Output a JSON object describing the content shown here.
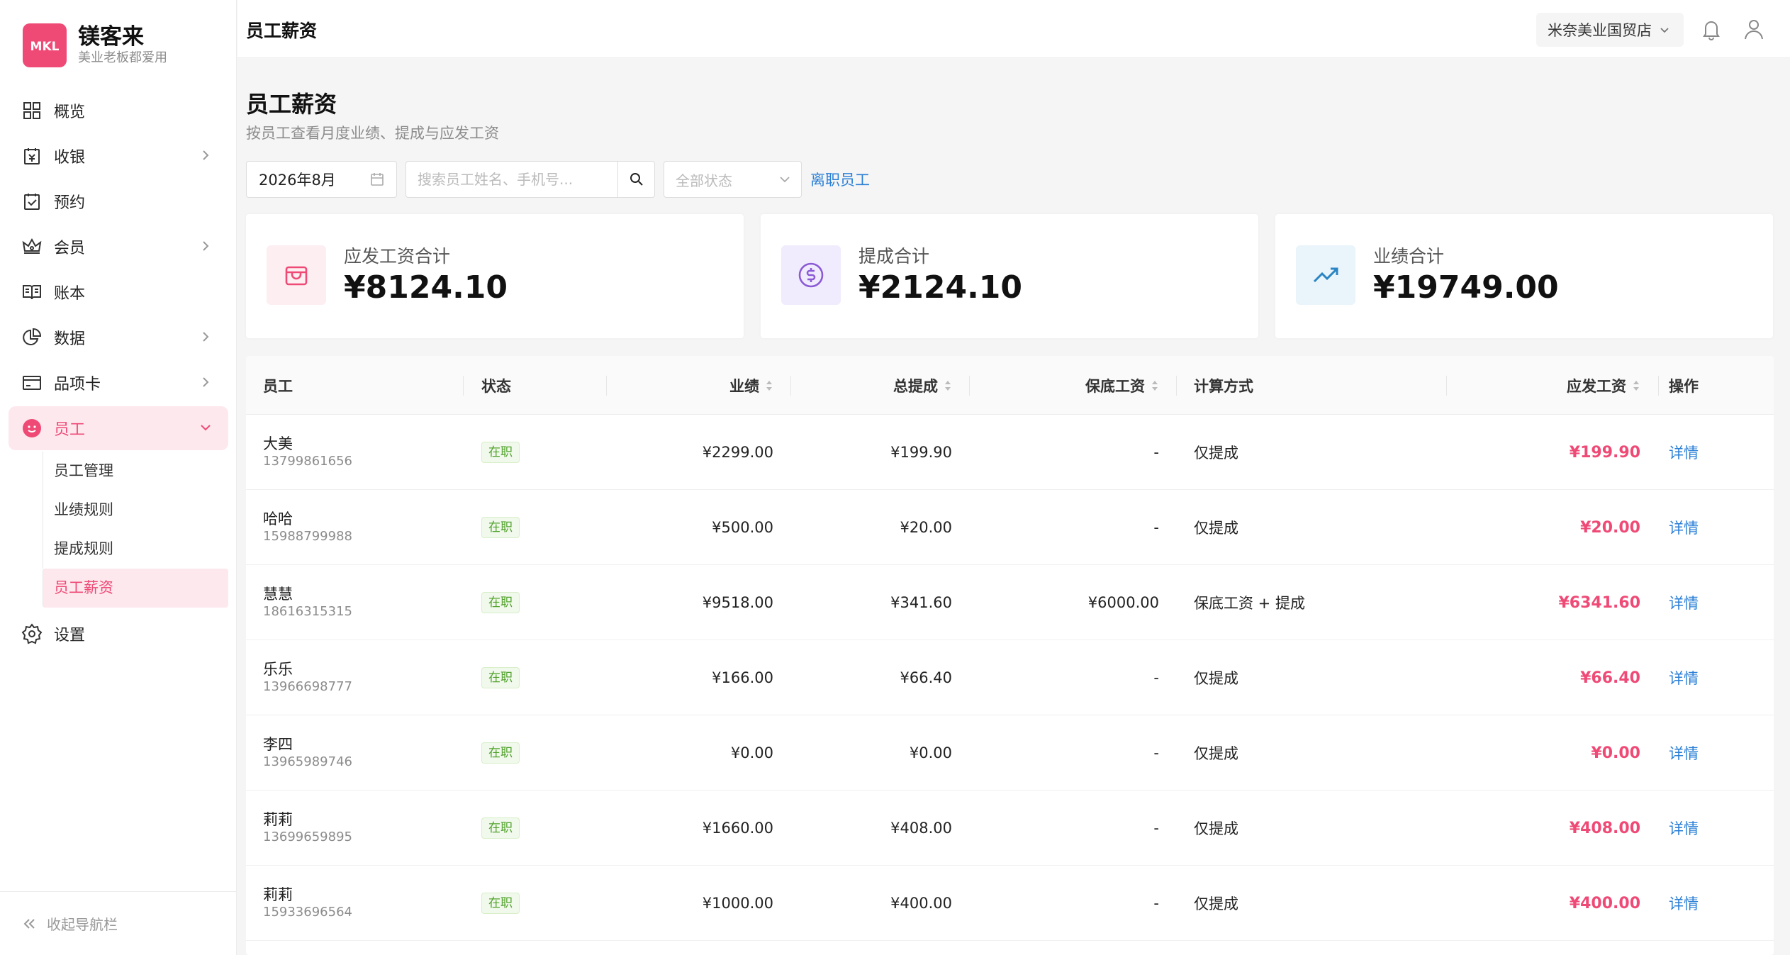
{
  "brand": {
    "name": "镁客来",
    "slogan": "美业老板都爱用",
    "logo_text": "MKL",
    "color": "#ef4a76"
  },
  "sidebar": {
    "items": [
      {
        "label": "概览",
        "icon": "dashboard-icon"
      },
      {
        "label": "收银",
        "icon": "cashier-icon",
        "has_children": true
      },
      {
        "label": "预约",
        "icon": "calendar-check-icon"
      },
      {
        "label": "会员",
        "icon": "crown-icon",
        "has_children": true
      },
      {
        "label": "账本",
        "icon": "book-icon"
      },
      {
        "label": "数据",
        "icon": "pie-chart-icon",
        "has_children": true
      },
      {
        "label": "品项卡",
        "icon": "card-icon",
        "has_children": true
      },
      {
        "label": "员工",
        "icon": "smile-icon",
        "has_children": true,
        "expanded": true
      }
    ],
    "staff_sub": [
      "员工管理",
      "业绩规则",
      "提成规则",
      "员工薪资"
    ],
    "settings_label": "设置",
    "collapse_label": "收起导航栏"
  },
  "header": {
    "title": "员工薪资",
    "store": "米奈美业国贸店"
  },
  "page": {
    "title": "员工薪资",
    "subtitle": "按员工查看月度业绩、提成与应发工资"
  },
  "filters": {
    "month": "2026年8月",
    "search_placeholder": "搜索员工姓名、手机号...",
    "status_placeholder": "全部状态",
    "resigned_link": "离职员工"
  },
  "summary": [
    {
      "label": "应发工资合计",
      "value": "¥8124.10",
      "icon": "wallet-icon",
      "bg": "#fdeef2",
      "color": "#ef4a76"
    },
    {
      "label": "提成合计",
      "value": "¥2124.10",
      "icon": "dollar-circle-icon",
      "bg": "#f1ecfd",
      "color": "#8b5ad6"
    },
    {
      "label": "业绩合计",
      "value": "¥19749.00",
      "icon": "trend-up-icon",
      "bg": "#e9f4fb",
      "color": "#2a85c2"
    }
  ],
  "table": {
    "columns": [
      "员工",
      "状态",
      "业绩",
      "总提成",
      "保底工资",
      "计算方式",
      "应发工资",
      "操作"
    ],
    "rows": [
      {
        "name": "大美",
        "phone": "13799861656",
        "status": "在职",
        "perf": "¥2299.00",
        "commission": "¥199.90",
        "base": "-",
        "method": "仅提成",
        "wage": "¥199.90",
        "action": "详情"
      },
      {
        "name": "哈哈",
        "phone": "15988799988",
        "status": "在职",
        "perf": "¥500.00",
        "commission": "¥20.00",
        "base": "-",
        "method": "仅提成",
        "wage": "¥20.00",
        "action": "详情"
      },
      {
        "name": "慧慧",
        "phone": "18616315315",
        "status": "在职",
        "perf": "¥9518.00",
        "commission": "¥341.60",
        "base": "¥6000.00",
        "method": "保底工资 + 提成",
        "wage": "¥6341.60",
        "action": "详情"
      },
      {
        "name": "乐乐",
        "phone": "13966698777",
        "status": "在职",
        "perf": "¥166.00",
        "commission": "¥66.40",
        "base": "-",
        "method": "仅提成",
        "wage": "¥66.40",
        "action": "详情"
      },
      {
        "name": "李四",
        "phone": "13965989746",
        "status": "在职",
        "perf": "¥0.00",
        "commission": "¥0.00",
        "base": "-",
        "method": "仅提成",
        "wage": "¥0.00",
        "action": "详情"
      },
      {
        "name": "莉莉",
        "phone": "13699659895",
        "status": "在职",
        "perf": "¥1660.00",
        "commission": "¥408.00",
        "base": "-",
        "method": "仅提成",
        "wage": "¥408.00",
        "action": "详情"
      },
      {
        "name": "莉莉",
        "phone": "15933696564",
        "status": "在职",
        "perf": "¥1000.00",
        "commission": "¥400.00",
        "base": "-",
        "method": "仅提成",
        "wage": "¥400.00",
        "action": "详情"
      }
    ]
  }
}
